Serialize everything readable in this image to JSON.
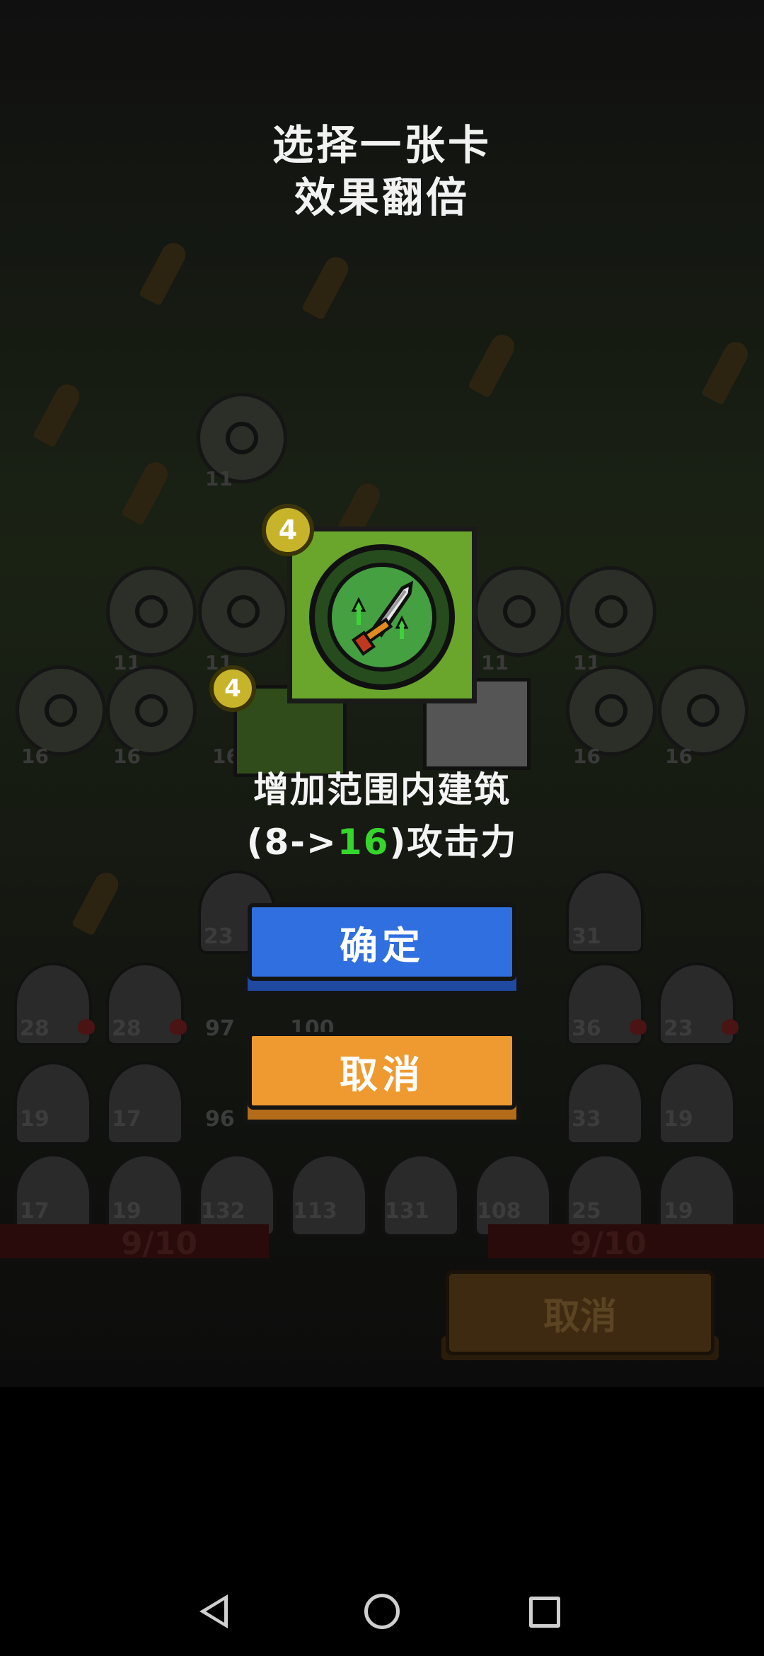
{
  "dialog": {
    "title_line1": "选择一张卡",
    "title_line2": "效果翻倍",
    "card": {
      "cost": "4",
      "icon": "sword-upgrade-icon",
      "background_color": "#6aa52c"
    },
    "behind_card_cost": "4",
    "description_line1": "增加范围内建筑",
    "description_open": "(8->",
    "description_new_value": "16",
    "description_close": ")攻击力",
    "confirm_label": "确定",
    "cancel_label": "取消"
  },
  "background": {
    "progress_left": "9/10",
    "progress_right": "9/10",
    "cancel_label": "取消",
    "cell_numbers_row1": [
      "11",
      "11"
    ],
    "cell_numbers_row2": [
      "11",
      "11",
      "11",
      "11",
      "11"
    ],
    "cell_numbers_row3": [
      "16",
      "16",
      "16",
      "16",
      "16"
    ],
    "troop_numbers_row1": [
      "23",
      "31"
    ],
    "troop_numbers_row2": [
      "28",
      "28",
      "97",
      "100",
      "36",
      "23"
    ],
    "troop_numbers_row3": [
      "19",
      "17",
      "96",
      "33",
      "19"
    ],
    "troop_numbers_row4": [
      "17",
      "19",
      "132",
      "113",
      "131",
      "108",
      "25",
      "19"
    ]
  },
  "navbar": {
    "back_icon": "back-triangle-icon",
    "home_icon": "home-circle-icon",
    "recent_icon": "recent-apps-square-icon"
  },
  "colors": {
    "confirm": "#2f6fe0",
    "cancel": "#ee9a30",
    "highlight_value": "#35d52c"
  }
}
